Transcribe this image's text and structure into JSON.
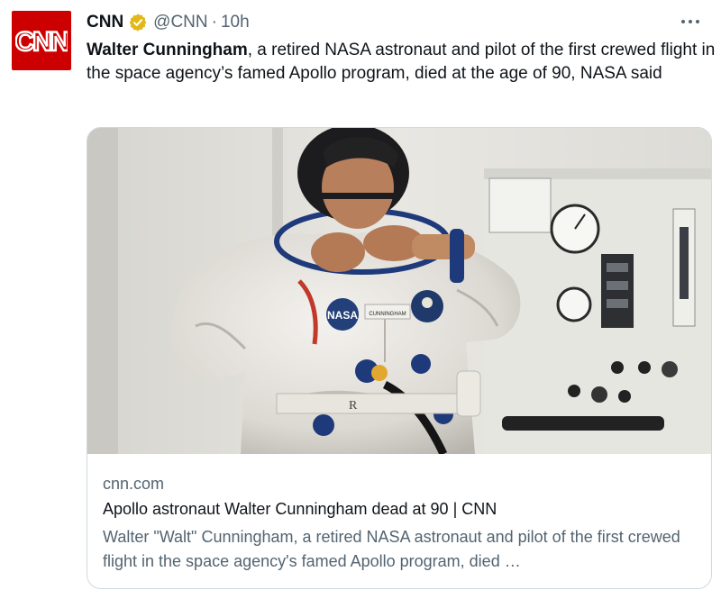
{
  "author": {
    "name": "CNN",
    "handle": "@CNN",
    "separator": "·",
    "time": "10h",
    "avatar_text": "CNN"
  },
  "tweet": {
    "bold_lead": "Walter Cunningham",
    "body_rest": ", a retired NASA astronaut and pilot of the first crewed flight in the space agency’s famed Apollo program, died at the age of 90, NASA said"
  },
  "card": {
    "domain": "cnn.com",
    "title": "Apollo astronaut Walter Cunningham dead at 90 | CNN",
    "description": "Walter \"Walt\" Cunningham, a retired NASA astronaut and pilot of the first crewed flight in the space agency's famed Apollo program, died …",
    "image_patch_nasa": "NASA",
    "image_name_tag": "CUNNINGHAM"
  },
  "icons": {
    "verified": "verified-badge-icon",
    "more": "more-options-icon"
  },
  "colors": {
    "brand_red": "#cc0000",
    "verified_gold": "#e2b719",
    "secondary_text": "#536471",
    "border": "#cfd9de"
  }
}
